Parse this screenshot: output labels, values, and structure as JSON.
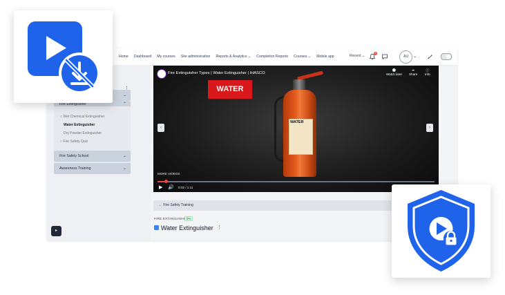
{
  "nav": {
    "items": [
      "Home",
      "Dashboard",
      "My courses",
      "Site administration",
      "Reports & Analytics",
      "Completion Reports",
      "Courses",
      "Mobile app"
    ],
    "recent_label": "Recent",
    "notification_count": "1",
    "avatar_initials": "AU"
  },
  "sidebar": {
    "section_fire_extinguisher": "Fire Extinguisher",
    "sub_items": [
      "Wet Chemical Extinguisher",
      "Water Extinguisher",
      "Dry Powder Extinguisher",
      "Fire Safety Quiz"
    ],
    "active_sub_item": "Water Extinguisher",
    "section_fire_safety_school": "Fire Safety School",
    "section_awareness_training": "Awareness Training"
  },
  "video": {
    "title": "Fire Extinguisher Types | Water Extinguisher | iHASCO",
    "watch_later": "Watch later",
    "share": "Share",
    "info": "Info",
    "sign_text": "WATER",
    "extinguisher_label": "WATER",
    "more_videos": "MORE VIDEOS",
    "time": "0:02 / 1:11",
    "progress_fraction": 0.03
  },
  "content": {
    "breadcrumb": "Fire Safety Training",
    "section_label": "FIRE EXTINGUISHER",
    "completion": "0%",
    "page_title": "Water Extinguisher"
  },
  "colors": {
    "accent_blue": "#1e63e9",
    "sign_red": "#d9181b",
    "sidebar_item": "#c9d1dc"
  },
  "icons": {
    "card_left": "video-no-download-icon",
    "card_right": "shield-video-lock-icon"
  }
}
